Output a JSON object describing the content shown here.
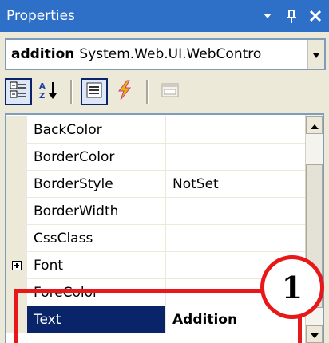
{
  "window": {
    "title": "Properties"
  },
  "selector": {
    "object_name": "addition",
    "object_type": "System.Web.UI.WebContro"
  },
  "toolbar": {
    "buttons": [
      {
        "name": "categorized-button",
        "icon": "categorized-icon"
      },
      {
        "name": "alphabetical-button",
        "icon": "sort-az-icon"
      },
      {
        "name": "properties-button",
        "icon": "properties-icon"
      },
      {
        "name": "events-button",
        "icon": "lightning-icon"
      },
      {
        "name": "property-pages-button",
        "icon": "property-pages-icon"
      }
    ]
  },
  "properties": [
    {
      "name": "BackColor",
      "value": ""
    },
    {
      "name": "BorderColor",
      "value": ""
    },
    {
      "name": "BorderStyle",
      "value": "NotSet"
    },
    {
      "name": "BorderWidth",
      "value": ""
    },
    {
      "name": "CssClass",
      "value": ""
    },
    {
      "name": "Font",
      "value": "",
      "expandable": true
    },
    {
      "name": "ForeColor",
      "value": ""
    },
    {
      "name": "Text",
      "value": "Addition",
      "selected": true
    }
  ],
  "annotation": {
    "callout_number": "1",
    "color": "#e81818"
  },
  "colors": {
    "titlebar": "#2e6fc7",
    "selection": "#0a246a",
    "chrome": "#ece9d8"
  }
}
